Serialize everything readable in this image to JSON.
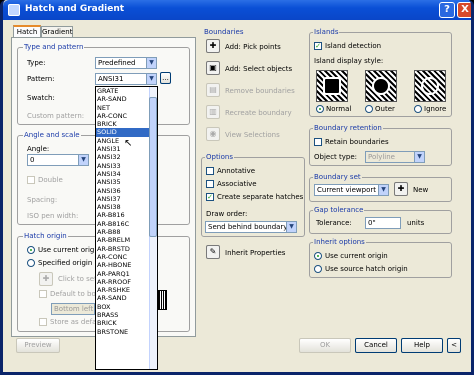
{
  "window": {
    "title": "Hatch and Gradient",
    "help": "?",
    "close": "X"
  },
  "tabs": [
    {
      "label": "Hatch"
    },
    {
      "label": "Gradient"
    }
  ],
  "type_pattern": {
    "group": "Type and pattern",
    "type_label": "Type:",
    "type_value": "Predefined",
    "pattern_label": "Pattern:",
    "pattern_value": "ANSI31",
    "swatch_label": "Swatch:",
    "custom_label": "Custom pattern:",
    "browse": "..."
  },
  "angle_scale": {
    "group": "Angle and scale",
    "angle_label": "Angle:",
    "angle_value": "0",
    "double": "Double",
    "spacing": "Spacing:",
    "iso": "ISO pen width:"
  },
  "hatch_origin": {
    "group": "Hatch origin",
    "use_current": "Use current origin",
    "specified": "Specified origin",
    "click_set": "Click to set new origin",
    "default_boundary": "Default to boundary extents",
    "bottom_left": "Bottom left",
    "store": "Store as default origin"
  },
  "pattern_list": [
    "GRATE",
    "AR-SAND",
    "NET",
    "AR-CONC",
    "BRICK",
    "SOLID",
    "ANGLE",
    "ANSI31",
    "ANSI32",
    "ANSI33",
    "ANSI34",
    "ANSI35",
    "ANSI36",
    "ANSI37",
    "ANSI38",
    "AR-B816",
    "AR-B816C",
    "AR-B88",
    "AR-BRELM",
    "AR-BRSTD",
    "AR-CONC",
    "AR-HBONE",
    "AR-PARQ1",
    "AR-RROOF",
    "AR-RSHKE",
    "AR-SAND",
    "BOX",
    "BRASS",
    "BRICK",
    "BRSTONE"
  ],
  "boundaries": {
    "group": "Boundaries",
    "add_pick": "Add: Pick points",
    "add_select": "Add: Select objects",
    "remove": "Remove boundaries",
    "recreate": "Recreate boundary",
    "view": "View Selections"
  },
  "options": {
    "group": "Options",
    "annotative": "Annotative",
    "associative": "Associative",
    "separate": "Create separate hatches",
    "draw_order": "Draw order:",
    "draw_order_value": "Send behind boundary"
  },
  "inherit": "Inherit Properties",
  "islands": {
    "group": "Islands",
    "detection": "Island detection",
    "style_label": "Island display style:",
    "normal": "Normal",
    "outer": "Outer",
    "ignore": "Ignore"
  },
  "retention": {
    "group": "Boundary retention",
    "retain": "Retain boundaries",
    "object_type": "Object type:",
    "object_value": "Polyline"
  },
  "boundary_set": {
    "group": "Boundary set",
    "value": "Current viewport",
    "new": "New"
  },
  "gap": {
    "group": "Gap tolerance",
    "label": "Tolerance:",
    "value": "0\"",
    "units": "units"
  },
  "inherit_options": {
    "group": "Inherit options",
    "use_current": "Use current origin",
    "use_source": "Use source hatch origin"
  },
  "footer": {
    "preview": "Preview",
    "ok": "OK",
    "cancel": "Cancel",
    "help": "Help",
    "more": "<"
  }
}
